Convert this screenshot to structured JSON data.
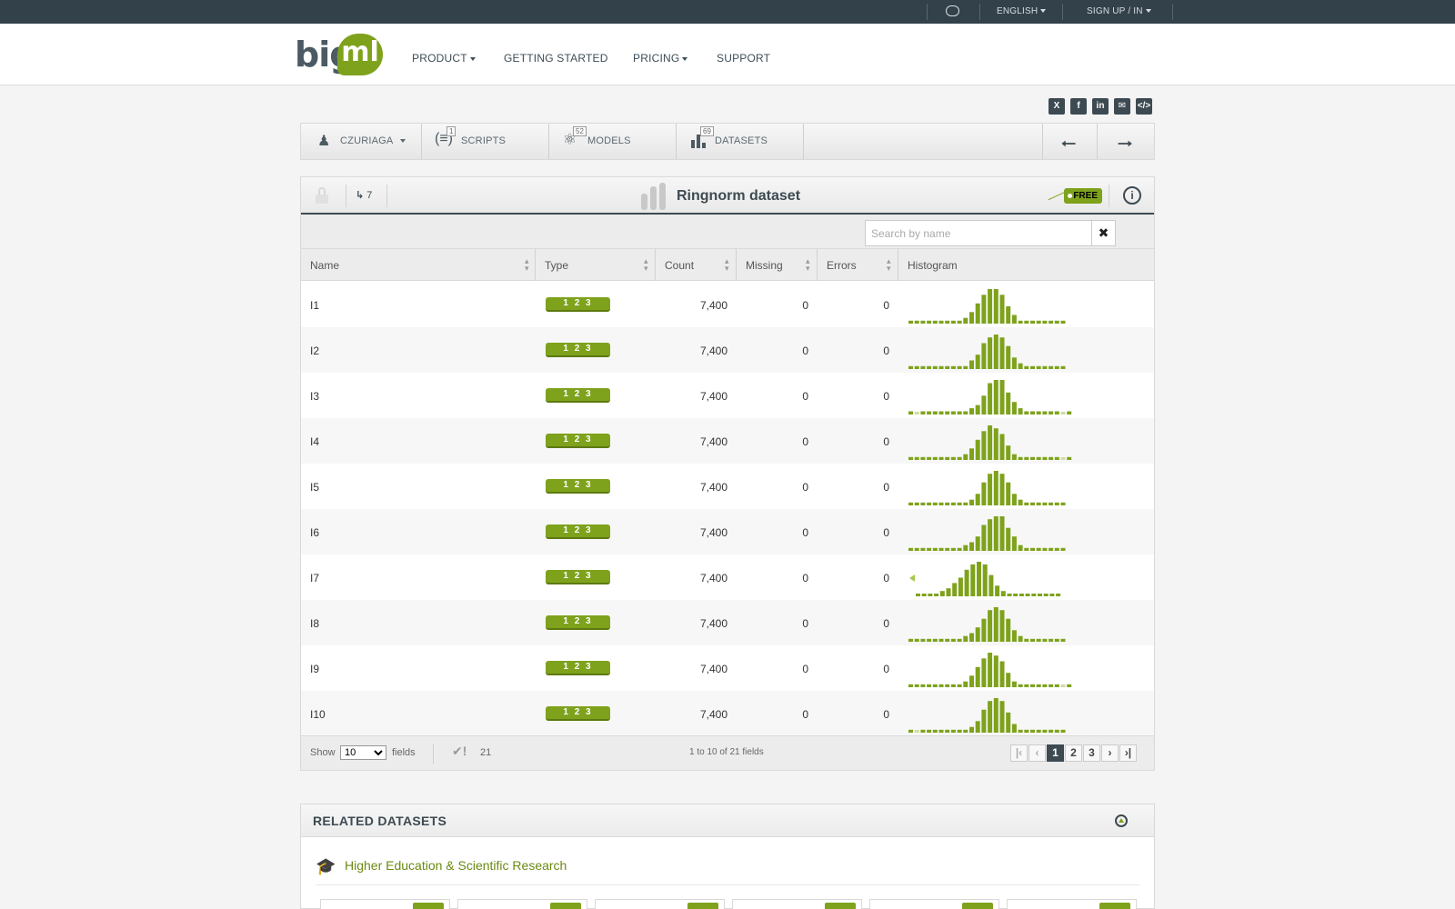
{
  "topbar": {
    "language_label": "ENGLISH",
    "sign_label": "SIGN UP / IN"
  },
  "header": {
    "logo_big": "big",
    "logo_ml": "ml",
    "nav": [
      {
        "label": "PRODUCT",
        "dropdown": true
      },
      {
        "label": "GETTING STARTED",
        "dropdown": false
      },
      {
        "label": "PRICING",
        "dropdown": true
      },
      {
        "label": "SUPPORT",
        "dropdown": false
      }
    ]
  },
  "share_icons": [
    "x-icon",
    "facebook-icon",
    "linkedin-icon",
    "email-icon",
    "embed-icon"
  ],
  "toolbar": {
    "user_label": "CZURIAGA",
    "scripts_label": "SCRIPTS",
    "scripts_count": "1",
    "models_label": "MODELS",
    "models_count": "52",
    "datasets_label": "DATASETS",
    "datasets_count": "69"
  },
  "dataset": {
    "title": "Ringnorm dataset",
    "clones_count": "7",
    "price_badge": "FREE",
    "search_placeholder": "Search by name",
    "columns": [
      "Name",
      "Type",
      "Count",
      "Missing",
      "Errors",
      "Histogram"
    ],
    "type_label": "1 2 3",
    "rows": [
      {
        "name": "I1",
        "count": "7,400",
        "missing": "0",
        "errors": "0",
        "hist": [
          1,
          1,
          1,
          1,
          1,
          1,
          1,
          1,
          1,
          2,
          4,
          7,
          10,
          12,
          12,
          10,
          6,
          3,
          1,
          1,
          1,
          1,
          1,
          1,
          1,
          1
        ]
      },
      {
        "name": "I2",
        "count": "7,400",
        "missing": "0",
        "errors": "0",
        "hist": [
          1,
          1,
          1,
          1,
          1,
          1,
          1,
          1,
          1,
          1,
          3,
          5,
          9,
          11,
          12,
          11,
          8,
          4,
          2,
          1,
          1,
          1,
          1,
          1,
          1,
          1
        ]
      },
      {
        "name": "I3",
        "count": "7,400",
        "missing": "0",
        "errors": "0",
        "hist": [
          1,
          0,
          1,
          1,
          1,
          1,
          1,
          1,
          1,
          1,
          2,
          3,
          6,
          10,
          11,
          11,
          7,
          4,
          2,
          1,
          1,
          1,
          1,
          1,
          1,
          0,
          1
        ]
      },
      {
        "name": "I4",
        "count": "7,400",
        "missing": "0",
        "errors": "0",
        "hist": [
          1,
          1,
          1,
          1,
          1,
          1,
          1,
          1,
          1,
          2,
          4,
          7,
          10,
          12,
          11,
          9,
          5,
          2,
          1,
          1,
          1,
          1,
          1,
          1,
          1,
          0,
          1
        ]
      },
      {
        "name": "I5",
        "count": "7,400",
        "missing": "0",
        "errors": "0",
        "hist": [
          1,
          1,
          1,
          1,
          1,
          1,
          1,
          1,
          1,
          1,
          2,
          4,
          8,
          11,
          12,
          11,
          8,
          4,
          2,
          1,
          1,
          1,
          1,
          1,
          1,
          1
        ]
      },
      {
        "name": "I6",
        "count": "7,400",
        "missing": "0",
        "errors": "0",
        "hist": [
          1,
          1,
          1,
          1,
          1,
          1,
          1,
          1,
          1,
          2,
          3,
          5,
          9,
          11,
          12,
          12,
          8,
          5,
          2,
          1,
          1,
          1,
          1,
          1,
          1,
          1
        ]
      },
      {
        "name": "I7",
        "count": "7,400",
        "missing": "0",
        "errors": "0",
        "hist": [
          1,
          1,
          1,
          1,
          2,
          3,
          5,
          7,
          10,
          12,
          13,
          12,
          8,
          4,
          2,
          1,
          1,
          1,
          1,
          1,
          1,
          1,
          1,
          1
        ]
      },
      {
        "name": "I8",
        "count": "7,400",
        "missing": "0",
        "errors": "0",
        "hist": [
          1,
          1,
          1,
          1,
          1,
          1,
          1,
          1,
          1,
          2,
          3,
          5,
          8,
          11,
          12,
          11,
          8,
          4,
          2,
          1,
          1,
          1,
          1,
          1,
          1,
          1
        ]
      },
      {
        "name": "I9",
        "count": "7,400",
        "missing": "0",
        "errors": "0",
        "hist": [
          1,
          1,
          1,
          1,
          1,
          1,
          1,
          1,
          1,
          2,
          4,
          7,
          10,
          12,
          11,
          9,
          5,
          2,
          1,
          1,
          1,
          1,
          1,
          1,
          1,
          0,
          1
        ]
      },
      {
        "name": "I10",
        "count": "7,400",
        "missing": "0",
        "errors": "0",
        "hist": [
          1,
          0,
          1,
          1,
          1,
          1,
          1,
          1,
          1,
          1,
          2,
          4,
          8,
          11,
          12,
          11,
          7,
          3,
          1,
          1,
          1,
          1,
          1,
          1,
          1,
          1
        ]
      }
    ],
    "footer": {
      "show_label": "Show",
      "show_value": "10",
      "fields_label": "fields",
      "preferred_count": "21",
      "range_text": "1 to 10 of 21 fields",
      "pages": [
        "1",
        "2",
        "3"
      ]
    }
  },
  "related": {
    "title": "RELATED DATASETS",
    "category": "Higher Education & Scientific Research"
  },
  "colors": {
    "accent_green": "#7ea21c",
    "dark_slate": "#33414a"
  }
}
